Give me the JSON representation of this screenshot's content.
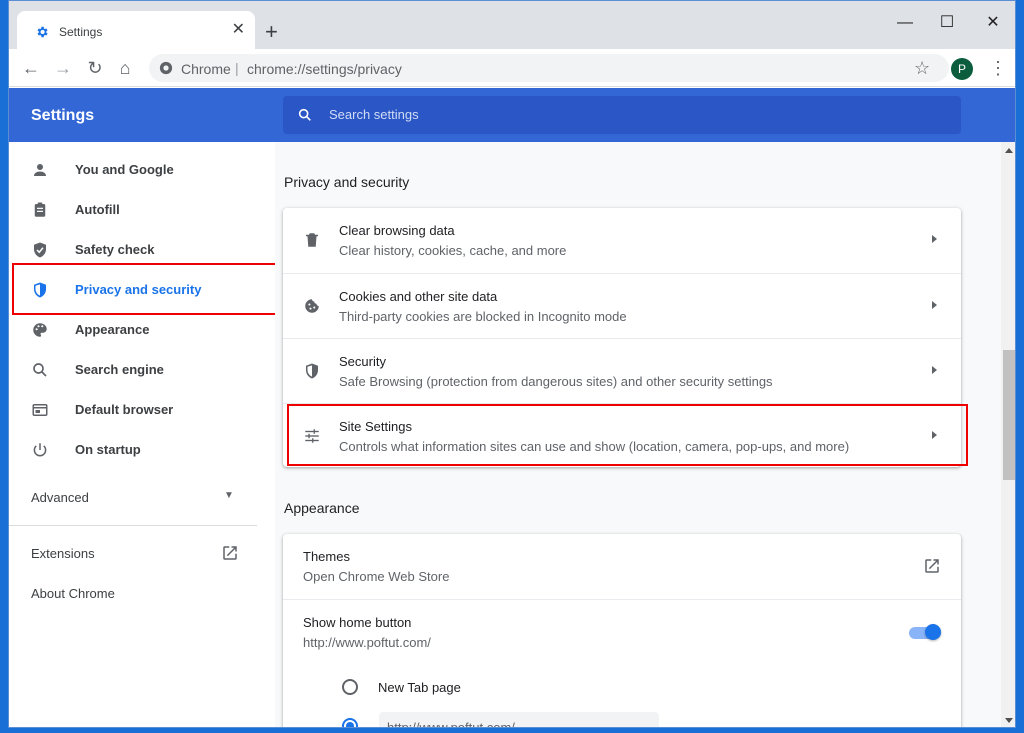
{
  "browser": {
    "tab_title": "Settings",
    "tab_close": "✕",
    "new_tab": "+",
    "win_minimize": "—",
    "win_maximize": "☐",
    "win_close": "✕",
    "omnibox_label": "Chrome",
    "omnibox_sep": "|",
    "url": "chrome://settings/privacy",
    "avatar_letter": "P",
    "back": "←",
    "forward": "→",
    "reload": "↻",
    "home": "⌂",
    "star": "☆",
    "menu": "⋮"
  },
  "header": {
    "title": "Settings",
    "search_placeholder": "Search settings"
  },
  "sidebar": {
    "items": [
      {
        "label": "You and Google",
        "icon": "person-icon"
      },
      {
        "label": "Autofill",
        "icon": "clipboard-icon"
      },
      {
        "label": "Safety check",
        "icon": "shield-check-icon"
      },
      {
        "label": "Privacy and security",
        "icon": "shield-icon",
        "active": true
      },
      {
        "label": "Appearance",
        "icon": "palette-icon"
      },
      {
        "label": "Search engine",
        "icon": "search-icon"
      },
      {
        "label": "Default browser",
        "icon": "browser-icon"
      },
      {
        "label": "On startup",
        "icon": "power-icon"
      }
    ],
    "advanced": "Advanced",
    "extensions": "Extensions",
    "about": "About Chrome"
  },
  "privacy": {
    "title": "Privacy and security",
    "rows": [
      {
        "title": "Clear browsing data",
        "sub": "Clear history, cookies, cache, and more",
        "icon": "trash-icon"
      },
      {
        "title": "Cookies and other site data",
        "sub": "Third-party cookies are blocked in Incognito mode",
        "icon": "cookie-icon"
      },
      {
        "title": "Security",
        "sub": "Safe Browsing (protection from dangerous sites) and other security settings",
        "icon": "shield-icon"
      },
      {
        "title": "Site Settings",
        "sub": "Controls what information sites can use and show (location, camera, pop-ups, and more)",
        "icon": "sliders-icon"
      }
    ]
  },
  "appearance": {
    "title": "Appearance",
    "themes_title": "Themes",
    "themes_sub": "Open Chrome Web Store",
    "home_title": "Show home button",
    "home_sub": "http://www.poftut.com/",
    "home_toggle_on": true,
    "radio_newtab": "New Tab page",
    "custom_url": "http://www.poftut.com/"
  },
  "colors": {
    "header_bg": "#3367d6",
    "accent": "#1a73e8",
    "highlight": "#e00000"
  }
}
